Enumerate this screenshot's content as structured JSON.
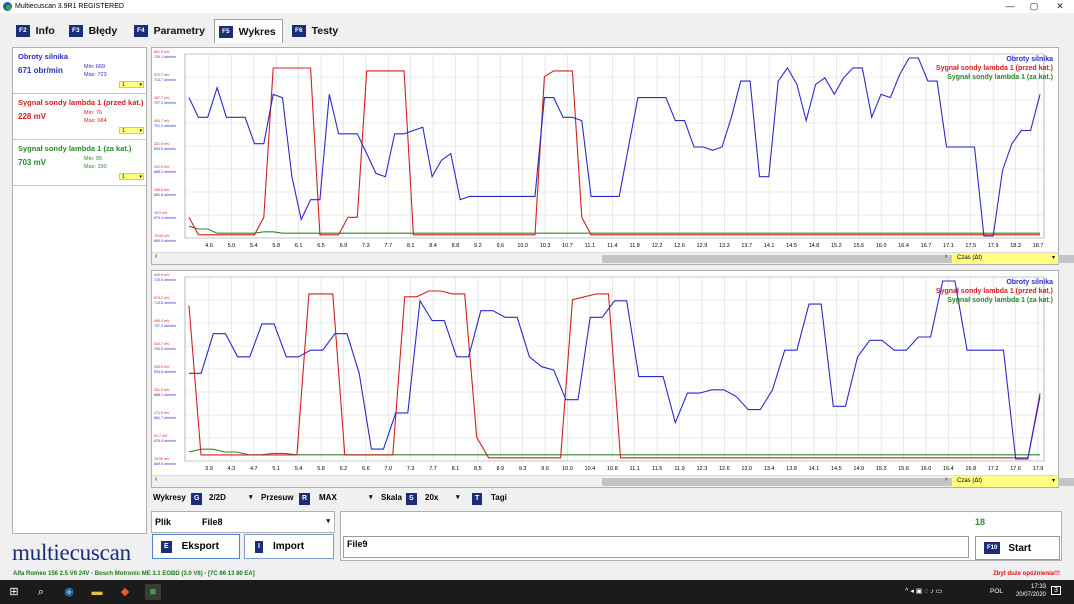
{
  "window": {
    "title": "Multiecuscan 3.9R1 REGISTERED",
    "minimize": "—",
    "maximize": "▢",
    "close": "✕"
  },
  "tabs": [
    {
      "key": "F2",
      "label": "Info"
    },
    {
      "key": "F3",
      "label": "Błędy"
    },
    {
      "key": "F4",
      "label": "Parametry"
    },
    {
      "key": "F5",
      "label": "Wykres"
    },
    {
      "key": "F6",
      "label": "Testy"
    }
  ],
  "params": [
    {
      "name": "Obroty silnika",
      "value": "671 obr/min",
      "min": "Min: 669",
      "max": "Max: 723",
      "scale": "1",
      "color": "#2a2acc"
    },
    {
      "name": "Sygnał sondy lambda 1 (przed kat.)",
      "value": "228 mV",
      "min": "Min: 76",
      "max": "Max: 684",
      "scale": "1",
      "color": "#d42020"
    },
    {
      "name": "Sygnał sondy lambda 1 (za kat.)",
      "value": "703 mV",
      "min": "Min: 95",
      "max": "Max: 190",
      "scale": "1",
      "color": "#2a8a2a"
    }
  ],
  "logo": "multiecuscan",
  "chart_data": [
    {
      "type": "line",
      "x_ticks": [
        "4.6",
        "5.0",
        "5.4",
        "5.8",
        "6.1",
        "6.5",
        "6.9",
        "7.3",
        "7.7",
        "8.1",
        "8.4",
        "8.8",
        "9.2",
        "9.6",
        "10.0",
        "10.3",
        "10.7",
        "11.1",
        "11.4",
        "11.8",
        "12.2",
        "12.6",
        "12.9",
        "13.3",
        "13.7",
        "14.1",
        "14.5",
        "14.8",
        "15.2",
        "15.6",
        "16.0",
        "16.4",
        "16.7",
        "17.1",
        "17.5",
        "17.9",
        "18.3",
        "18.7"
      ],
      "y_labels_blue": [
        "720.1 obr/min",
        "713.7 obr/min",
        "707.3 obr/min",
        "701.0 obr/min",
        "694.6 obr/min",
        "688.2 obr/min",
        "681.8 obr/min",
        "675.4 obr/min",
        "669.0 obr/min"
      ],
      "y_labels_red": [
        "651.9 mV",
        "570.7 mV",
        "487.7 mV",
        "404.7 mV",
        "321.9 mV",
        "241.9 mV",
        "159.9 mV",
        "76.9 mV",
        "76.00 mV"
      ],
      "ylim_rpm": [
        669,
        723
      ],
      "ylim_mv": [
        76,
        684
      ],
      "ylim_mv2": [
        95,
        190
      ],
      "series": [
        {
          "name": "Obroty silnika",
          "color": "#2a2acc",
          "values": [
            711,
            705,
            705,
            714,
            705,
            705,
            705,
            697,
            697,
            712,
            711,
            687,
            674,
            680,
            680,
            712,
            700,
            700,
            700,
            694,
            688,
            687,
            700,
            700,
            701,
            702,
            687,
            692,
            694,
            680,
            681,
            681,
            681,
            681,
            681,
            681,
            681,
            681,
            711,
            711,
            705,
            705,
            704,
            681,
            681,
            681,
            681,
            696,
            711,
            711,
            711,
            711,
            704,
            704,
            696,
            696,
            695,
            696,
            705,
            716,
            716,
            687,
            687,
            716,
            720,
            715,
            704,
            715,
            717,
            712,
            717,
            720,
            720,
            705,
            712,
            711,
            718,
            723,
            723,
            716,
            716,
            696,
            696,
            696,
            696,
            669,
            669,
            689,
            697,
            701,
            701,
            712
          ]
        },
        {
          "name": "Sygnał sondy lambda 1 (przed kat.)",
          "color": "#d42020",
          "values": [
            140,
            80,
            80,
            80,
            80,
            80,
            80,
            80,
            140,
            650,
            650,
            650,
            650,
            650,
            80,
            80,
            80,
            140,
            140,
            640,
            640,
            640,
            640,
            640,
            80,
            80,
            80,
            80,
            80,
            80,
            80,
            80,
            80,
            80,
            80,
            80,
            80,
            80,
            620,
            640,
            640,
            640,
            140,
            80,
            80,
            80,
            80,
            80,
            80,
            80,
            80,
            80,
            80,
            80,
            80,
            80,
            80,
            80,
            80,
            80,
            80,
            80,
            80,
            80,
            80,
            80,
            80,
            80,
            80,
            80,
            80,
            80,
            80,
            80,
            80,
            80,
            80,
            80,
            80,
            80,
            80,
            80,
            80,
            80,
            80,
            80,
            80,
            80,
            80,
            80,
            80,
            80
          ]
        },
        {
          "name": "Sygnał sondy lambda 1 (za kat.)",
          "color": "#2a8a2a",
          "values": [
            130,
            120,
            120,
            105,
            105,
            105,
            105,
            105,
            110,
            110,
            105,
            105,
            105,
            105,
            105,
            105,
            105,
            105,
            105,
            105,
            105,
            105,
            105,
            105,
            105,
            105,
            105,
            105,
            105,
            105,
            105,
            105,
            105,
            105,
            105,
            105,
            105,
            105,
            105,
            105,
            105,
            105,
            105,
            105,
            105,
            105,
            105,
            105,
            105,
            105,
            105,
            105,
            105,
            105,
            105,
            105,
            105,
            105,
            105,
            105,
            105,
            105,
            105,
            105,
            105,
            105,
            105,
            105,
            105,
            105,
            105,
            105,
            105,
            105,
            105,
            105,
            105,
            105,
            105,
            105,
            105,
            105,
            105,
            105,
            105,
            105,
            105,
            105,
            105,
            105,
            105,
            105
          ]
        }
      ],
      "legend": [
        "Obroty silnika",
        "Sygnał sondy lambda 1 (przed kat.)",
        "Sygnał sondy lambda 1 (za kat.)"
      ],
      "x_axis": "Czas (Δt)"
    },
    {
      "type": "line",
      "x_ticks": [
        "3.9",
        "4.3",
        "4.7",
        "5.1",
        "5.4",
        "5.8",
        "6.2",
        "6.6",
        "7.0",
        "7.3",
        "7.7",
        "8.1",
        "8.5",
        "8.9",
        "9.3",
        "9.6",
        "10.0",
        "10.4",
        "10.8",
        "11.1",
        "11.5",
        "11.9",
        "12.3",
        "12.6",
        "13.0",
        "13.4",
        "13.8",
        "14.1",
        "14.5",
        "14.9",
        "15.3",
        "15.6",
        "16.0",
        "16.4",
        "16.8",
        "17.2",
        "17.6",
        "17.9"
      ],
      "y_labels_blue": [
        "720.0 obr/min",
        "713.6 obr/min",
        "707.2 obr/min",
        "700.9 obr/min",
        "694.5 obr/min",
        "688.1 obr/min",
        "681.7 obr/min",
        "675.4 obr/min",
        "669.0 obr/min"
      ],
      "y_labels_red": [
        "649.9 mV",
        "570.2 mV",
        "490.4 mV",
        "410.7 mV",
        "330.9 mV",
        "251.2 mV",
        "171.5 mV",
        "91.7 mV",
        "76.00 mV"
      ],
      "ylim_rpm": [
        669,
        723
      ],
      "ylim_mv": [
        76,
        684
      ],
      "ylim_mv2": [
        95,
        190
      ],
      "series": [
        {
          "name": "Obroty silnika",
          "color": "#2a2acc",
          "values": [
            695,
            695,
            707,
            707,
            700,
            700,
            710,
            710,
            700,
            700,
            702,
            702,
            707,
            707,
            695,
            672,
            672,
            683,
            683,
            717,
            711,
            711,
            700,
            700,
            714,
            714,
            712,
            712,
            700,
            697,
            696,
            687,
            687,
            712,
            712,
            717,
            717,
            694,
            694,
            694,
            680,
            689,
            689,
            690,
            690,
            688,
            684,
            684,
            690,
            702,
            702,
            716,
            716,
            685,
            685,
            700,
            705,
            705,
            702,
            702,
            706,
            706,
            723,
            723,
            702,
            702,
            702,
            702,
            669,
            669,
            688
          ]
        },
        {
          "name": "Sygnał sondy lambda 1 (przed kat.)",
          "color": "#d42020",
          "values": [
            600,
            90,
            90,
            90,
            90,
            90,
            90,
            90,
            90,
            90,
            640,
            640,
            640,
            90,
            90,
            90,
            90,
            90,
            630,
            630,
            650,
            650,
            640,
            640,
            150,
            80,
            80,
            80,
            80,
            80,
            80,
            80,
            620,
            630,
            640,
            640,
            80,
            80,
            80,
            80,
            80,
            80,
            80,
            80,
            80,
            80,
            80,
            80,
            80,
            80,
            80,
            80,
            80,
            80,
            80,
            80,
            80,
            80,
            80,
            80,
            80,
            80,
            80,
            80,
            80,
            80,
            80,
            80,
            80,
            80,
            80,
            300
          ]
        },
        {
          "name": "Sygnał sondy lambda 1 (za kat.)",
          "color": "#2a8a2a",
          "values": [
            120,
            130,
            130,
            120,
            120,
            110,
            110,
            115,
            115,
            110,
            110,
            110,
            110,
            110,
            110,
            110,
            110,
            110,
            110,
            110,
            110,
            110,
            110,
            110,
            110,
            110,
            110,
            110,
            110,
            110,
            110,
            110,
            110,
            110,
            110,
            110,
            110,
            110,
            110,
            110,
            110,
            110,
            110,
            110,
            110,
            110,
            110,
            110,
            110,
            110,
            110,
            110,
            110,
            110,
            110,
            110,
            110,
            110,
            110,
            110,
            110,
            110,
            110,
            110,
            110,
            110,
            110,
            110,
            110,
            110,
            110,
            110
          ]
        }
      ],
      "legend": [
        "Obroty silnika",
        "Sygnał sondy lambda 1 (przed kat.)",
        "Sygnał sondy lambda 1 (za kat.)"
      ],
      "x_axis": "Czas (Δt)"
    }
  ],
  "controls": {
    "wykresy_label": "Wykresy",
    "g_key": "G",
    "wykresy_val": "2/2D",
    "przesuw_label": "Przesuw",
    "r_key": "R",
    "przesuw_val": "MAX",
    "skala_label": "Skala",
    "s_key": "S",
    "skala_val": "20x",
    "t_key": "T",
    "tagi_label": "Tagi"
  },
  "plik": {
    "label": "Plik",
    "value": "File8"
  },
  "buttons": {
    "eksport_key": "E",
    "eksport": "Eksport",
    "import_key": "I",
    "import": "Import",
    "start_key": "F10",
    "start": "Start"
  },
  "file_field": "File9",
  "count": "18",
  "status": {
    "vehicle": "Alfa Romeo 156 2.5 V6 24V - Bosch Motronic ME 3.1 EOBD (3.0 V6) - [7C 86 13 80 EA]",
    "warning": "Zbyt duże opóźnienia!!!"
  },
  "taskbar": {
    "lang": "POL",
    "time": "17:33",
    "date": "20/07/2020",
    "notif": "3"
  }
}
